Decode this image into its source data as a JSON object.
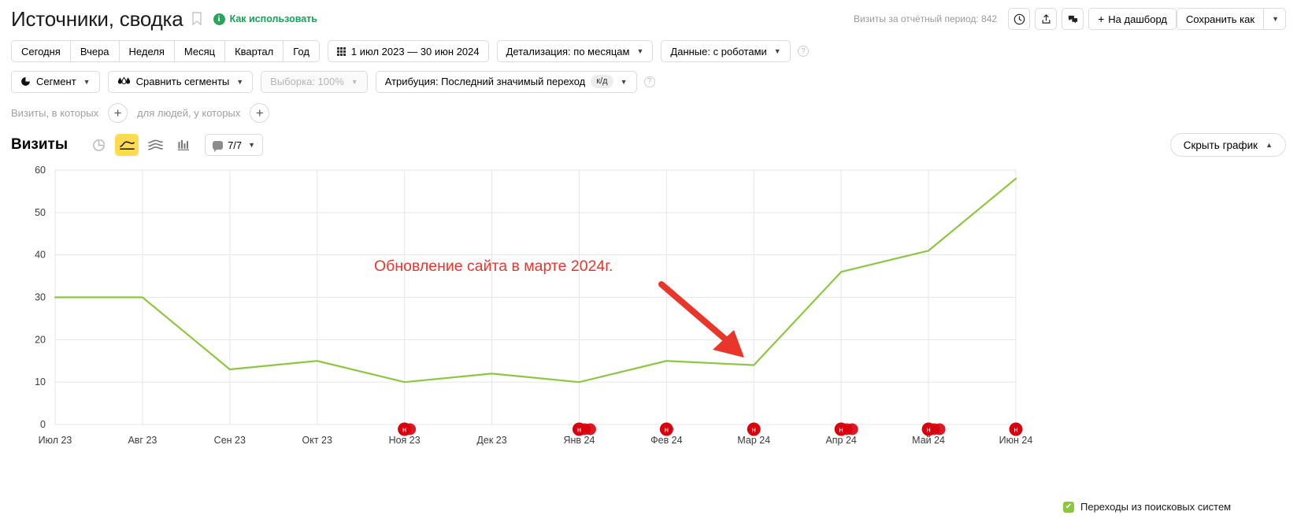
{
  "header": {
    "title": "Источники, сводка",
    "bookmark_icon": "bookmark-icon",
    "how_to_use": "Как использовать",
    "info_icon": "info-icon",
    "visits_summary": "Визиты за отчётный период: 842",
    "icons": [
      {
        "name": "history-clock-icon",
        "glyph": "clock"
      },
      {
        "name": "export-share-icon",
        "glyph": "export"
      },
      {
        "name": "comments-icon",
        "glyph": "comments"
      }
    ],
    "dashboard_button": "На дашборд",
    "dashboard_plus": "+",
    "save_as_button": "Сохранить как",
    "save_as_chevron": "chevron-down-icon"
  },
  "periods": {
    "buttons": [
      "Сегодня",
      "Вчера",
      "Неделя",
      "Месяц",
      "Квартал",
      "Год"
    ],
    "date_range": "1 июл 2023 — 30 июн 2024",
    "calendar_icon": "calendar-icon",
    "detalization": "Детализация: по месяцам",
    "data_source": "Данные: с роботами",
    "help_icon": "question-mark-icon"
  },
  "segments": {
    "segment": "Сегмент",
    "segment_icon": "pie-chart-icon",
    "compare_segments": "Сравнить сегменты",
    "compare_icon": "compare-drops-icon",
    "sampling": "Выборка: 100%",
    "attribution": "Атрибуция: Последний значимый переход",
    "attribution_badge": "к/д",
    "help_icon": "question-mark-icon"
  },
  "filters": {
    "visits_label": "Визиты, в которых",
    "people_label": "для людей, у которых",
    "add_icon": "plus-icon"
  },
  "chart_toolbar": {
    "metric_title": "Визиты",
    "view_types": [
      {
        "name": "pie-chart-view-icon",
        "active": false
      },
      {
        "name": "line-chart-view-icon",
        "active": true
      },
      {
        "name": "area-chart-view-icon",
        "active": false
      },
      {
        "name": "bar-chart-view-icon",
        "active": false
      }
    ],
    "metrics_count": "7/7",
    "metrics_icon": "speech-bubble-icon",
    "metrics_chevron": "chevron-down-icon",
    "hide_chart": "Скрыть график",
    "hide_chart_chevron": "chevron-up-icon"
  },
  "chart_data": {
    "type": "line",
    "title": "Визиты",
    "xlabel": "",
    "ylabel": "",
    "ylim": [
      0,
      60
    ],
    "yticks": [
      0,
      10,
      20,
      30,
      40,
      50,
      60
    ],
    "grid": true,
    "legend_position": "right",
    "categories": [
      "Июл 23",
      "Авг 23",
      "Сен 23",
      "Окт 23",
      "Ноя 23",
      "Дек 23",
      "Янв 24",
      "Фев 24",
      "Мар 24",
      "Апр 24",
      "Май 24",
      "Июн 24"
    ],
    "series": [
      {
        "name": "Переходы из поисковых систем",
        "color": "#8ec641",
        "values": [
          30,
          30,
          13,
          15,
          10,
          12,
          10,
          15,
          14,
          36,
          41,
          58
        ]
      }
    ],
    "annotations": [
      {
        "text": "Обновление сайта в марте 2024г.",
        "color": "#e8362a",
        "arrow": "red-arrow-pointing-to-march-2024"
      }
    ],
    "event_markers": [
      {
        "category": "Ноя 23",
        "label": "н",
        "extra": 1
      },
      {
        "category": "Янв 24",
        "label": "н",
        "extra": 2
      },
      {
        "category": "Фев 24",
        "label": "н",
        "extra": 0
      },
      {
        "category": "Мар 24",
        "label": "н",
        "extra": 0
      },
      {
        "category": "Апр 24",
        "label": "н",
        "extra": 2
      },
      {
        "category": "Май 24",
        "label": "н",
        "extra": 2
      },
      {
        "category": "Июн 24",
        "label": "н",
        "extra": 0
      }
    ]
  },
  "legend": {
    "label": "Переходы из поисковых систем",
    "check_glyph": "✔",
    "color": "#8ec641"
  }
}
